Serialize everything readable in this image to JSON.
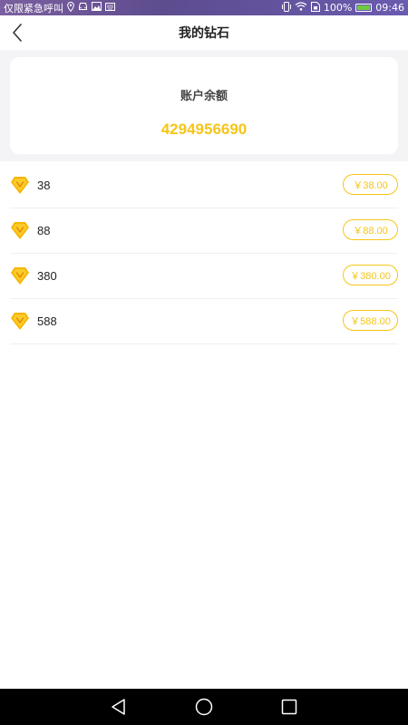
{
  "statusbar": {
    "carrier_text": "仅限紧急呼叫",
    "battery": "100%",
    "time": "09:46",
    "left_icons": [
      "location-icon",
      "car-icon",
      "image-icon",
      "keyboard-icon"
    ],
    "right_icons": [
      "vibrate-icon",
      "wifi-icon",
      "sim-icon",
      "battery-icon"
    ]
  },
  "header": {
    "title": "我的钻石",
    "back_icon": "back-arrow-icon"
  },
  "balance": {
    "label": "账户余额",
    "value": "4294956690"
  },
  "colors": {
    "accent": "#f5c518",
    "page_bg": "#f4f4f6",
    "nav_bg": "#000000"
  },
  "packages": [
    {
      "amount": "38",
      "price": "￥38.00"
    },
    {
      "amount": "88",
      "price": "￥88.00"
    },
    {
      "amount": "380",
      "price": "￥380.00"
    },
    {
      "amount": "588",
      "price": "￥588.00"
    }
  ],
  "navbar": {
    "icons": [
      "nav-back-icon",
      "nav-home-icon",
      "nav-recents-icon"
    ]
  }
}
